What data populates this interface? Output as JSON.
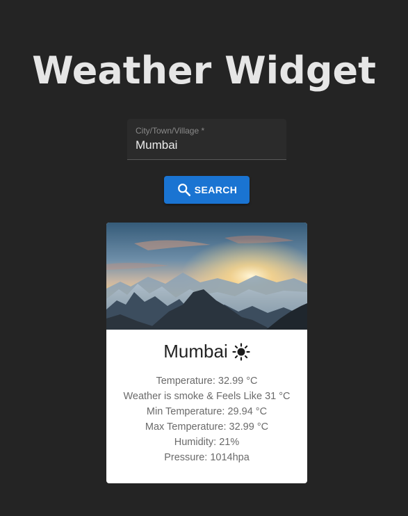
{
  "page": {
    "title": "Weather Widget"
  },
  "search": {
    "label": "City/Town/Village *",
    "value": "Mumbai",
    "button_label": "SEARCH",
    "button_icon": "search-icon"
  },
  "card": {
    "city": "Mumbai",
    "weather_icon": "sun-icon",
    "image": "mountain-sunrise-landscape",
    "details": {
      "temperature": "Temperature: 32.99 °C",
      "feels_like": "Weather is smoke & Feels Like 31 °C",
      "min_temp": "Min Temperature: 29.94 °C",
      "max_temp": "Max Temperature: 32.99 °C",
      "humidity": "Humidity: 21%",
      "pressure": "Pressure: 1014hpa"
    }
  },
  "colors": {
    "background": "#242424",
    "title": "#e6e6e6",
    "button": "#1a74d2",
    "card": "#ffffff"
  }
}
